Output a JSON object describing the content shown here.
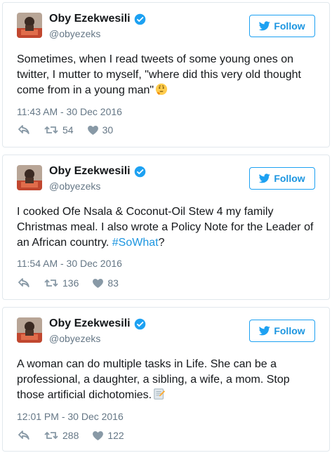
{
  "colors": {
    "accent": "#1da1f2",
    "link": "#1b95e0",
    "muted": "#657786",
    "border": "#e1e8ed"
  },
  "tweets": [
    {
      "name": "Oby Ezekwesili",
      "handle": "@obyezeks",
      "follow_label": "Follow",
      "text_before": "Sometimes, when I read tweets of some young ones on twitter, I mutter to myself, \"where did this very old thought come from in a young man\"",
      "hashtag": "",
      "text_after": "",
      "emoji": "thinking-face-emoji",
      "timestamp": "11:43 AM - 30 Dec 2016",
      "retweets": "54",
      "likes": "30"
    },
    {
      "name": "Oby Ezekwesili",
      "handle": "@obyezeks",
      "follow_label": "Follow",
      "text_before": "I cooked Ofe Nsala & Coconut-Oil Stew 4 my family Christmas meal. I also wrote a Policy Note for the Leader of an African country. ",
      "hashtag": "#SoWhat",
      "text_after": "?",
      "emoji": "",
      "timestamp": "11:54 AM - 30 Dec 2016",
      "retweets": "136",
      "likes": "83"
    },
    {
      "name": "Oby Ezekwesili",
      "handle": "@obyezeks",
      "follow_label": "Follow",
      "text_before": "A woman can do multiple tasks in Life. She can be a professional, a daughter, a sibling, a wife, a mom. Stop those artificial dichotomies.",
      "hashtag": "",
      "text_after": "",
      "emoji": "memo-emoji",
      "timestamp": "12:01 PM - 30 Dec 2016",
      "retweets": "288",
      "likes": "122"
    }
  ]
}
